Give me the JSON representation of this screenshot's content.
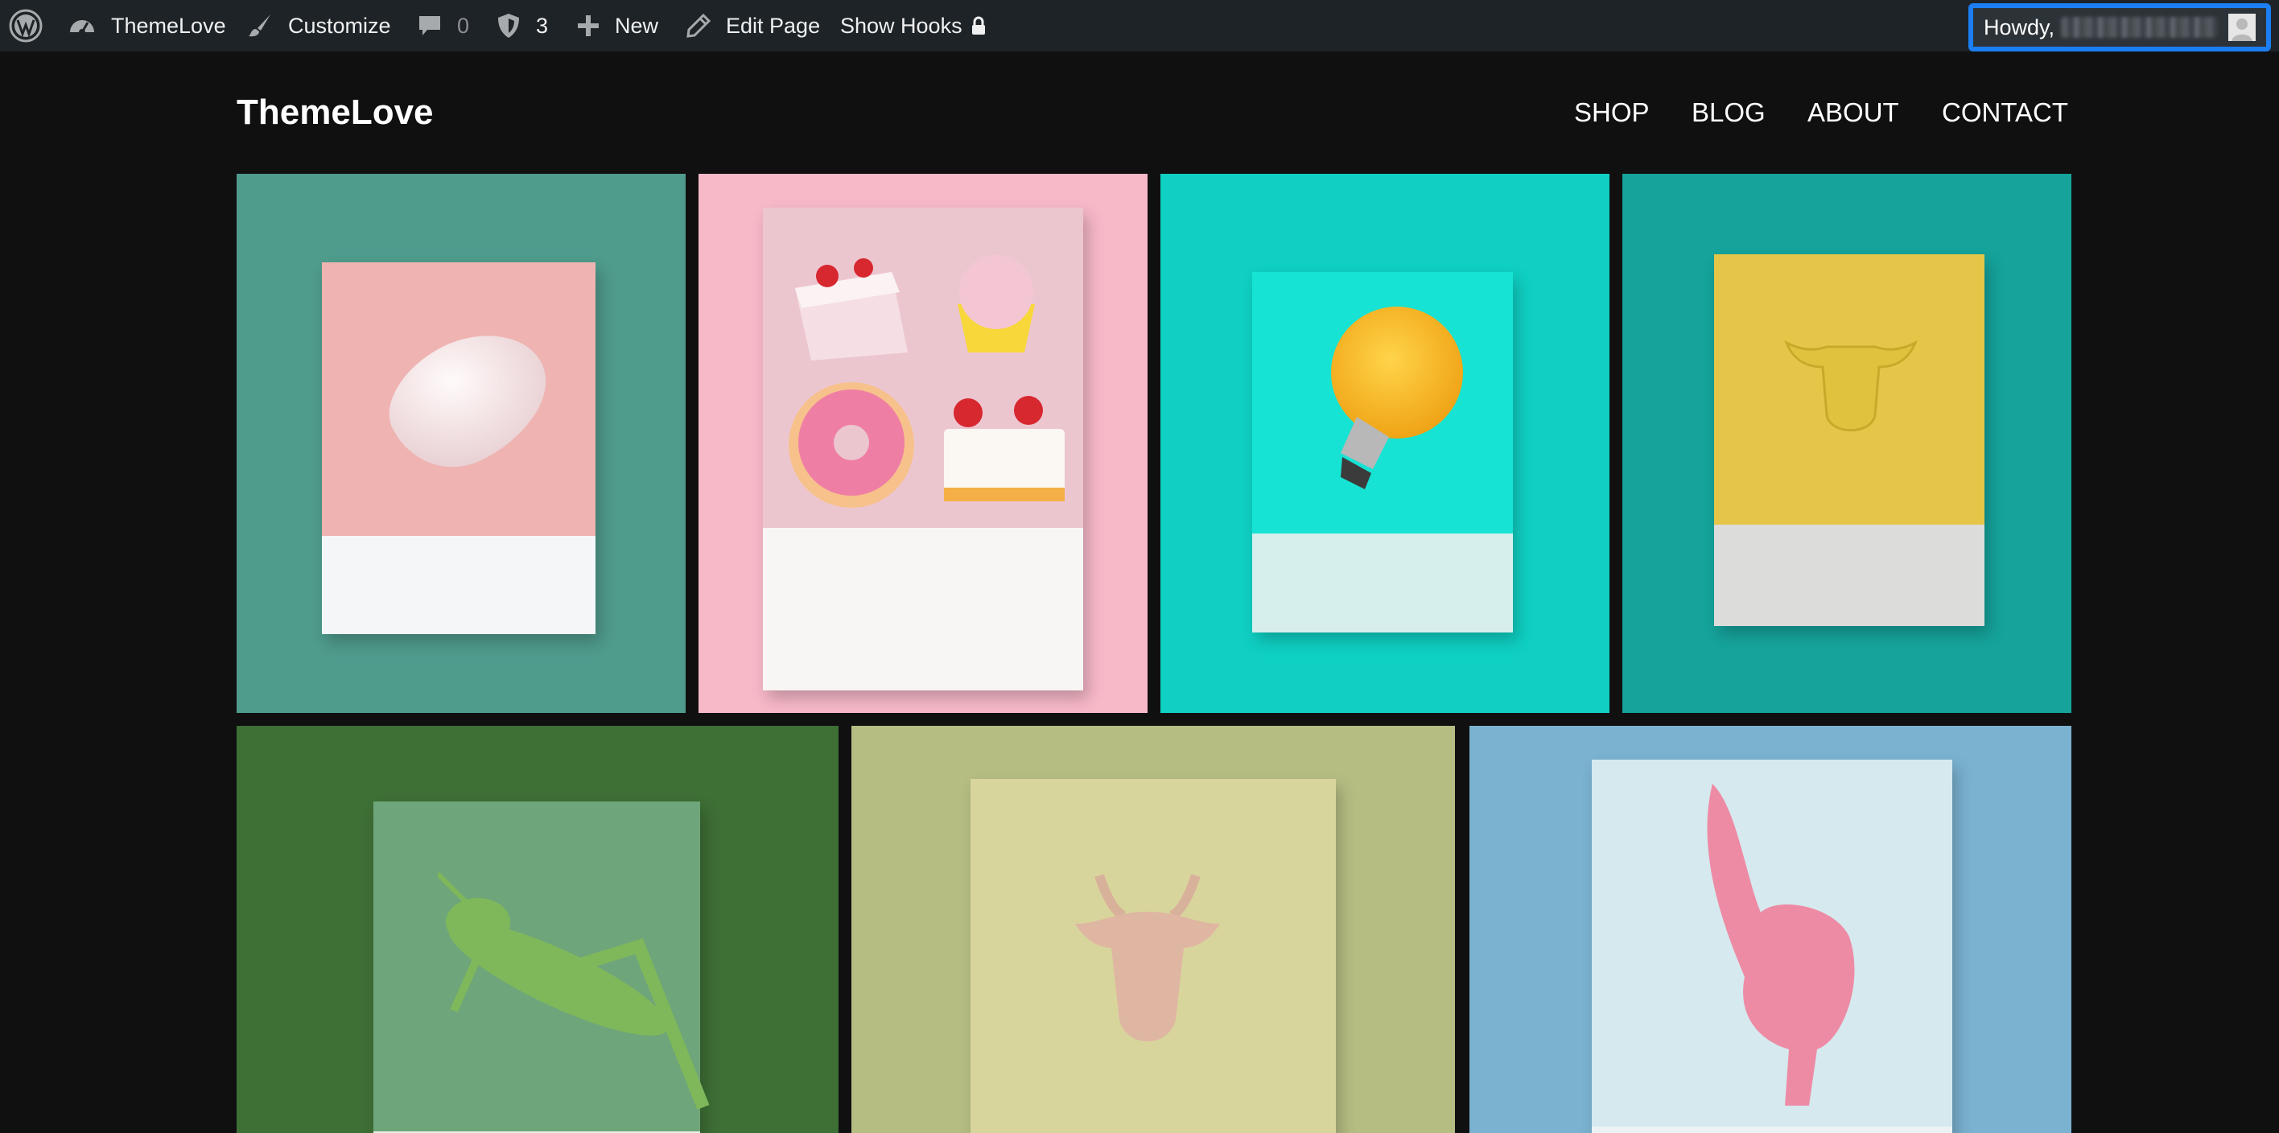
{
  "admin_bar": {
    "site_name": "ThemeLove",
    "customize_label": "Customize",
    "comments_count": "0",
    "updates_count": "3",
    "new_label": "New",
    "edit_page_label": "Edit Page",
    "show_hooks_label": "Show Hooks",
    "howdy_label": "Howdy,",
    "icons": [
      "wordpress-logo-icon",
      "dashboard-icon",
      "brush-icon",
      "comment-icon",
      "shield-icon",
      "plus-icon",
      "pencil-icon",
      "lock-icon",
      "avatar"
    ]
  },
  "site": {
    "title": "ThemeLove",
    "nav": [
      "SHOP",
      "BLOG",
      "ABOUT",
      "CONTACT"
    ]
  },
  "gallery": {
    "items": [
      {
        "subject": "rose quartz stone",
        "background": "#4f9b8c",
        "card_top": "#efb3b2",
        "card_bottom": "#f5f6f7"
      },
      {
        "subject": "pastries and cupcake",
        "background": "#f7b8c8",
        "card_top": "#ecc6cf",
        "card_bottom": "#f7f6f5"
      },
      {
        "subject": "yellow light bulb",
        "background": "#0fd0c3",
        "card_top": "#16e3d3",
        "card_bottom": "#d6efec"
      },
      {
        "subject": "yellow bull head",
        "background": "#15a39b",
        "card_top": "#e5c648",
        "card_bottom": "#dcdcda"
      },
      {
        "subject": "green grasshopper",
        "background": "#3e6f35",
        "card_top": "#6fa57a",
        "card_bottom": "#e9efe8"
      },
      {
        "subject": "beige goat head",
        "background": "#b6bd83",
        "card_top": "#d8d59c",
        "card_bottom": "#eceee6"
      },
      {
        "subject": "pink furry animal",
        "background": "#7ab2d0",
        "card_top": "#d6e9ef",
        "card_bottom": "#ecf2f4"
      }
    ]
  }
}
